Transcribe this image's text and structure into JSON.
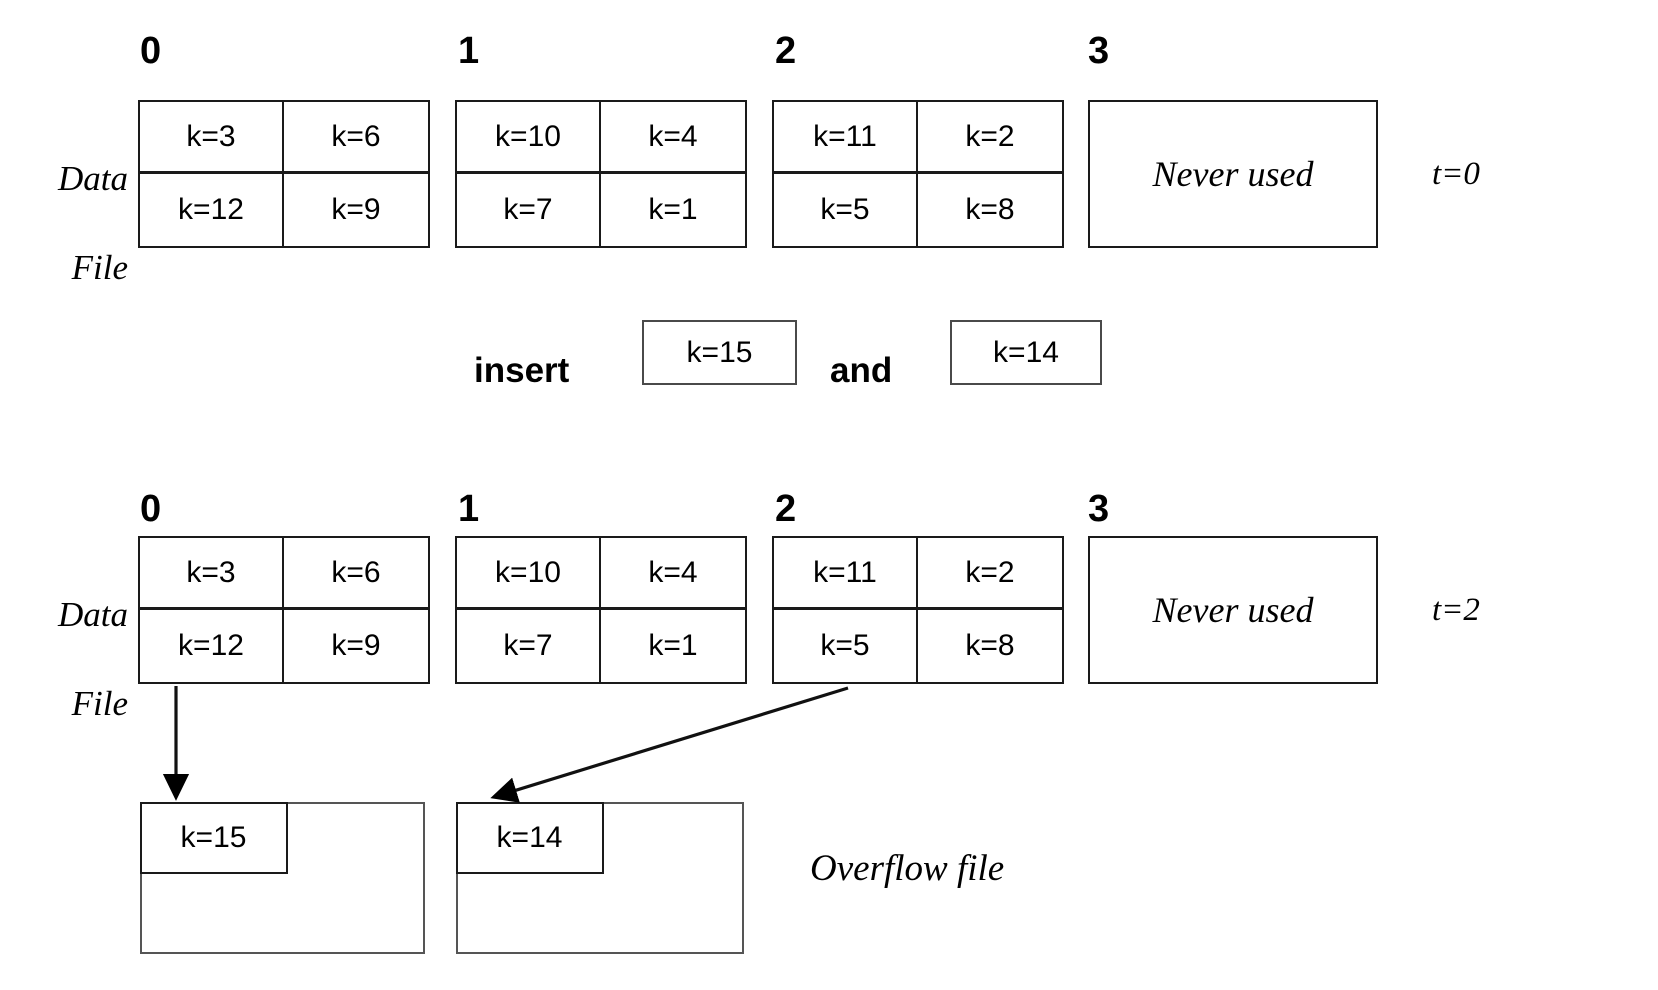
{
  "figure": {
    "side_label_line1": "Data",
    "side_label_line2": "File",
    "overflow_caption": "Overflow file",
    "never_used_text": "Never used"
  },
  "states": [
    {
      "id": "state-t0",
      "time_label": "t=0",
      "bucket_indices": [
        "0",
        "1",
        "2",
        "3"
      ],
      "buckets": [
        {
          "index": "0",
          "slots": [
            "k=3",
            "k=6",
            "k=12",
            "k=9"
          ]
        },
        {
          "index": "1",
          "slots": [
            "k=10",
            "k=4",
            "k=7",
            "k=1"
          ]
        },
        {
          "index": "2",
          "slots": [
            "k=11",
            "k=2",
            "k=5",
            "k=8"
          ]
        }
      ],
      "empty_bucket": {
        "index": "3",
        "label": "Never used"
      }
    },
    {
      "id": "state-t2",
      "time_label": "t=2",
      "bucket_indices": [
        "0",
        "1",
        "2",
        "3"
      ],
      "buckets": [
        {
          "index": "0",
          "slots": [
            "k=3",
            "k=6",
            "k=12",
            "k=9"
          ]
        },
        {
          "index": "1",
          "slots": [
            "k=10",
            "k=4",
            "k=7",
            "k=1"
          ]
        },
        {
          "index": "2",
          "slots": [
            "k=11",
            "k=2",
            "k=5",
            "k=8"
          ]
        }
      ],
      "empty_bucket": {
        "index": "3",
        "label": "Never used"
      },
      "overflow_blocks": [
        {
          "index": "0",
          "key": "k=15"
        },
        {
          "index": "1",
          "key": "k=14"
        }
      ]
    }
  ],
  "operation": {
    "verb": "insert",
    "conjunction": "and",
    "key_first": "k=15",
    "key_second": "k=14"
  },
  "colors": {
    "stroke": "#1a1a1a",
    "light_stroke": "#555555",
    "background": "#ffffff",
    "text": "#000000"
  }
}
